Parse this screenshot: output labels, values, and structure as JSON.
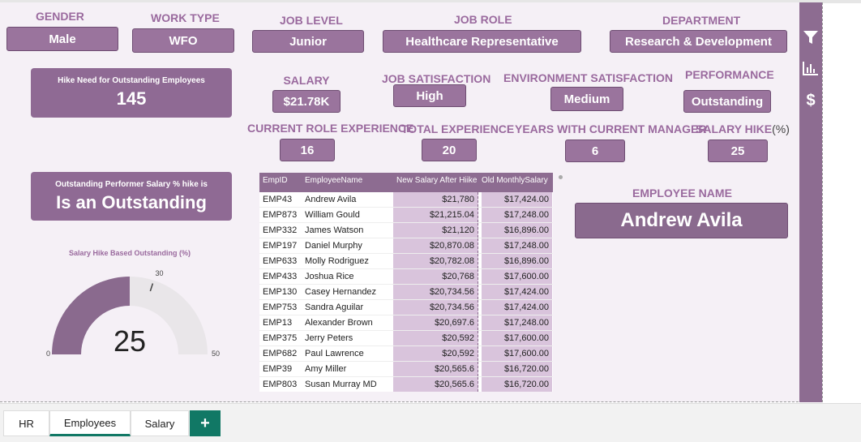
{
  "filters": {
    "gender": {
      "label": "GENDER",
      "value": "Male"
    },
    "work_type": {
      "label": "WORK TYPE",
      "value": "WFO"
    },
    "job_level": {
      "label": "JOB LEVEL",
      "value": "Junior"
    },
    "job_role": {
      "label": "JOB ROLE",
      "value": "Healthcare Representative"
    },
    "department": {
      "label": "DEPARTMENT",
      "value": "Research & Development"
    }
  },
  "kpis": {
    "hike_need": {
      "title": "Hike Need for Outstanding Employees",
      "value": "145"
    },
    "performer_hike": {
      "title": "Outstanding Performer Salary % hike is",
      "value": "Is an Outstanding"
    }
  },
  "stats": {
    "salary": {
      "label": "SALARY",
      "value": "$21.78K"
    },
    "job_satisfaction": {
      "label": "JOB SATISFACTION",
      "value": "High"
    },
    "env_satisfaction": {
      "label": "ENVIRONMENT SATISFACTION",
      "value": "Medium"
    },
    "performance": {
      "label": "PERFORMANCE",
      "value": "Outstanding"
    },
    "current_role_exp": {
      "label": "CURRENT ROLE EXPERIENCE",
      "value": "16"
    },
    "total_exp": {
      "label": "TOTAL EXPERIENCE",
      "value": "20"
    },
    "years_manager": {
      "label": "YEARS WITH CURRENT MANAGER",
      "value": "6"
    },
    "salary_hike": {
      "label": "SALARY HIKE",
      "suffix": "(%)",
      "value": "25"
    }
  },
  "gauge": {
    "title": "Salary Hike Based Outstanding (%)",
    "value": 25,
    "value_label": "25",
    "min": 0,
    "max": 50,
    "target": 30,
    "min_label": "0",
    "max_label": "50",
    "target_label": "30"
  },
  "employee": {
    "label": "EMPLOYEE NAME",
    "value": "Andrew Avila"
  },
  "table": {
    "headers": [
      "EmpID",
      "EmployeeName",
      "New Salary After Hiike",
      "Old MonthlySalary"
    ],
    "rows": [
      [
        "EMP43",
        "Andrew Avila",
        "$21,780",
        "$17,424.00"
      ],
      [
        "EMP873",
        "William Gould",
        "$21,215.04",
        "$17,248.00"
      ],
      [
        "EMP332",
        "James Watson",
        "$21,120",
        "$16,896.00"
      ],
      [
        "EMP197",
        "Daniel Murphy",
        "$20,870.08",
        "$17,248.00"
      ],
      [
        "EMP633",
        "Molly Rodriguez",
        "$20,782.08",
        "$16,896.00"
      ],
      [
        "EMP433",
        "Joshua Rice",
        "$20,768",
        "$17,600.00"
      ],
      [
        "EMP130",
        "Casey Hernandez",
        "$20,734.56",
        "$17,424.00"
      ],
      [
        "EMP753",
        "Sandra Aguilar",
        "$20,734.56",
        "$17,424.00"
      ],
      [
        "EMP13",
        "Alexander Brown",
        "$20,697.6",
        "$17,248.00"
      ],
      [
        "EMP375",
        "Jerry Peters",
        "$20,592",
        "$17,600.00"
      ],
      [
        "EMP682",
        "Paul Lawrence",
        "$20,592",
        "$17,600.00"
      ],
      [
        "EMP39",
        "Amy Miller",
        "$20,565.6",
        "$16,720.00"
      ],
      [
        "EMP803",
        "Susan Murray MD",
        "$20,565.6",
        "$16,720.00"
      ]
    ]
  },
  "tabs": {
    "hr": "HR",
    "employees": "Employees",
    "salary": "Salary",
    "add": "+"
  },
  "icons": [
    "filter-icon",
    "bar-chart-icon",
    "dollar-icon"
  ]
}
